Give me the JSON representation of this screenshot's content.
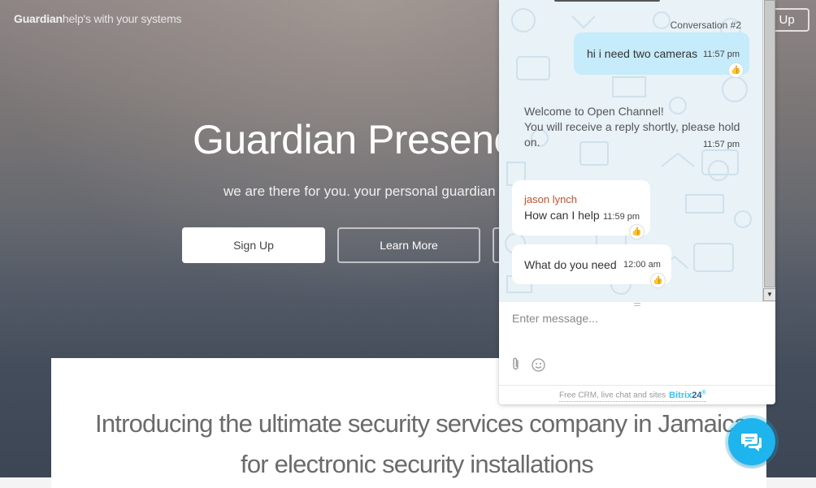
{
  "header": {
    "brand_bold": "Guardian",
    "brand_rest": "help's with your systems",
    "signup_label": "n Up"
  },
  "hero": {
    "title": "Guardian Presence F",
    "subtitle": "we are there for you. your personal guardian ar",
    "signup_button": "Sign Up",
    "learn_button": "Learn More"
  },
  "intro": {
    "line1": "Introducing the ultimate security services company in Jamaica ,",
    "line2": "for electronic security installations"
  },
  "chat": {
    "conversation_label": "Conversation #2",
    "messages": [
      {
        "text": "hi i need two cameras",
        "time": "11:57 pm"
      },
      {
        "line1": "Welcome to Open Channel!",
        "line2": "You will receive a reply shortly, please hold",
        "line3": "on.",
        "time": "11:57 pm"
      },
      {
        "author": "jason lynch",
        "text": "How can I help",
        "time": "11:59 pm"
      },
      {
        "text": "What do you need",
        "time": "12:00 am"
      }
    ],
    "input_placeholder": "Enter message...",
    "powered_text": "Free CRM, live chat and sites",
    "brand_main": "Bitrix",
    "brand_num": "24",
    "brand_mark": "®"
  },
  "icons": {
    "like": "thumbs-up-icon",
    "attach": "paperclip-icon",
    "smile": "smiley-icon",
    "launcher": "chat-bubbles-icon"
  },
  "colors": {
    "accent": "#1eb4ee",
    "outgoing_bubble": "#c6ebfa",
    "author": "#c0522f"
  }
}
